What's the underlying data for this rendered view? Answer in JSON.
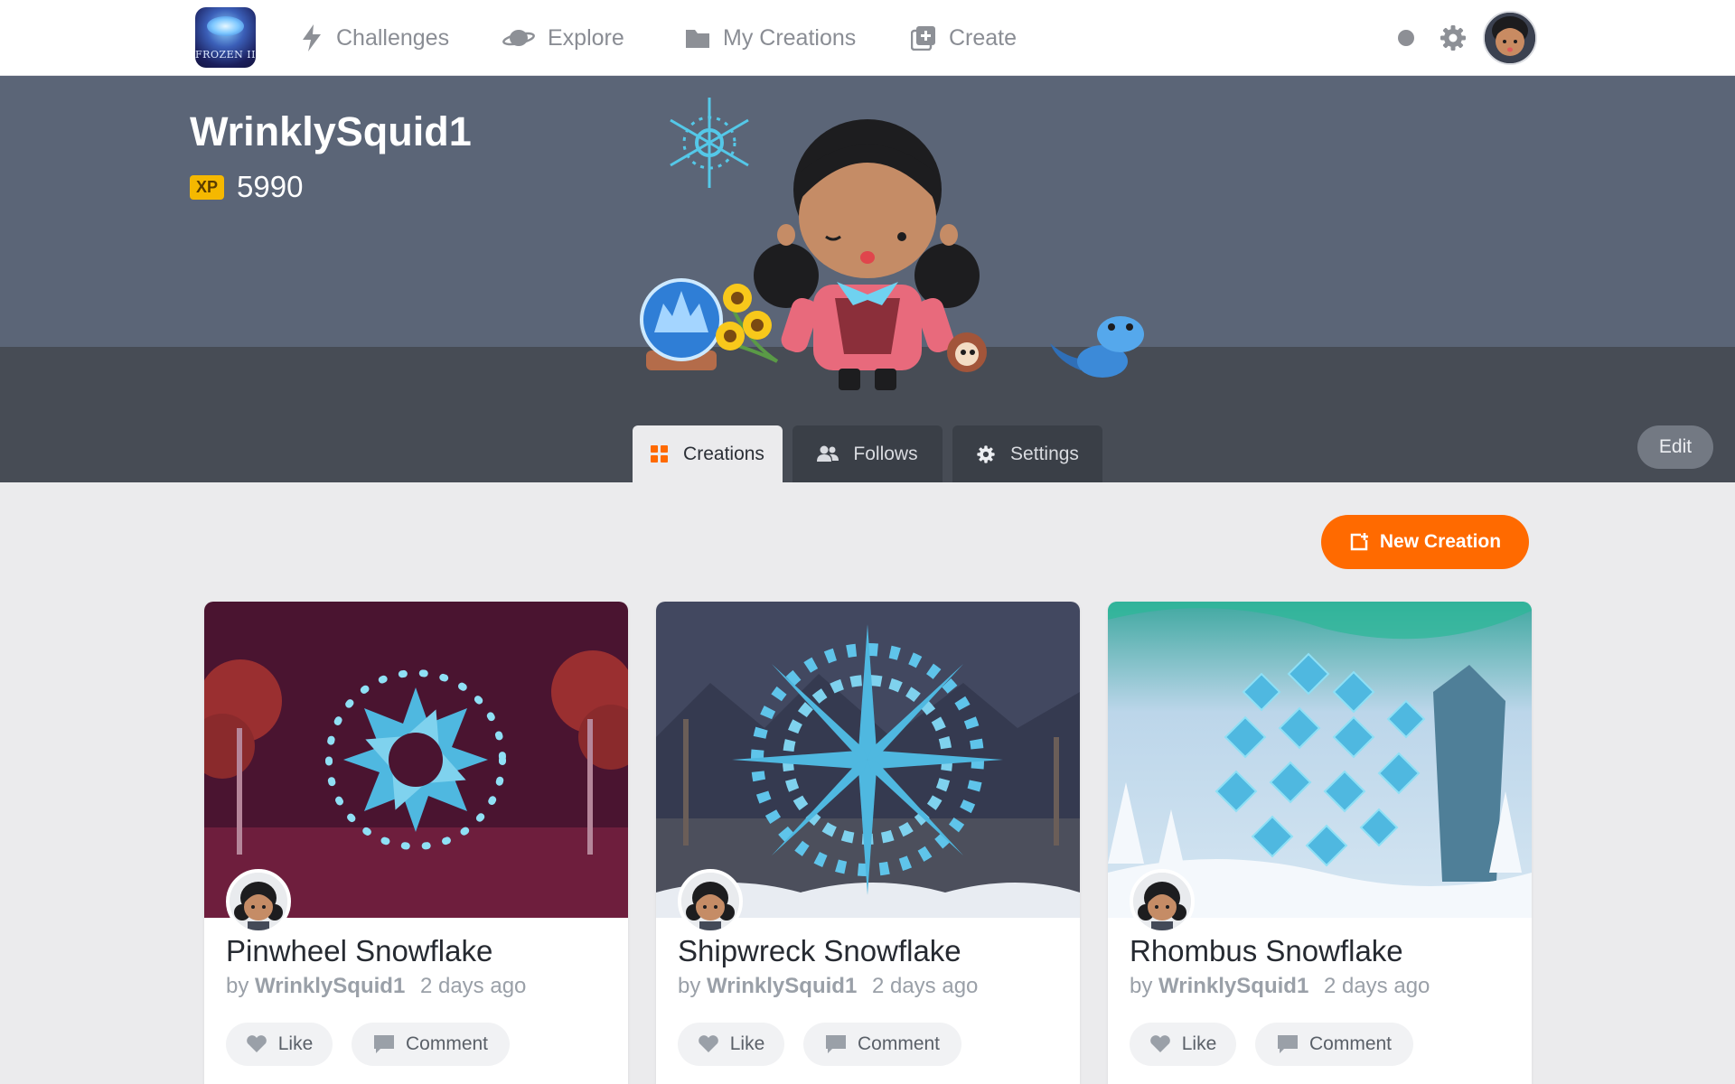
{
  "nav": {
    "app_logo_text": "FROZEN II",
    "items": [
      {
        "label": "Challenges",
        "icon": "lightning-icon"
      },
      {
        "label": "Explore",
        "icon": "planet-icon"
      },
      {
        "label": "My Creations",
        "icon": "folder-icon"
      },
      {
        "label": "Create",
        "icon": "add-square-icon"
      }
    ]
  },
  "profile": {
    "username": "WrinklySquid1",
    "xp_badge": "XP",
    "xp_value": "5990"
  },
  "tabs": [
    {
      "label": "Creations",
      "icon": "grid-icon",
      "active": true
    },
    {
      "label": "Follows",
      "icon": "people-icon",
      "active": false
    },
    {
      "label": "Settings",
      "icon": "gear-icon",
      "active": false
    }
  ],
  "edit_label": "Edit",
  "new_creation_label": "New Creation",
  "cards": [
    {
      "title": "Pinwheel Snowflake",
      "by": "by",
      "author": "WrinklySquid1",
      "time": "2 days ago",
      "like": "Like",
      "comment": "Comment"
    },
    {
      "title": "Shipwreck Snowflake",
      "by": "by",
      "author": "WrinklySquid1",
      "time": "2 days ago",
      "like": "Like",
      "comment": "Comment"
    },
    {
      "title": "Rhombus Snowflake",
      "by": "by",
      "author": "WrinklySquid1",
      "time": "2 days ago",
      "like": "Like",
      "comment": "Comment"
    }
  ],
  "colors": {
    "accent": "#ff6a00",
    "banner": "#5b6577",
    "banner_floor": "#474c55",
    "xp_badge": "#f5b800"
  }
}
